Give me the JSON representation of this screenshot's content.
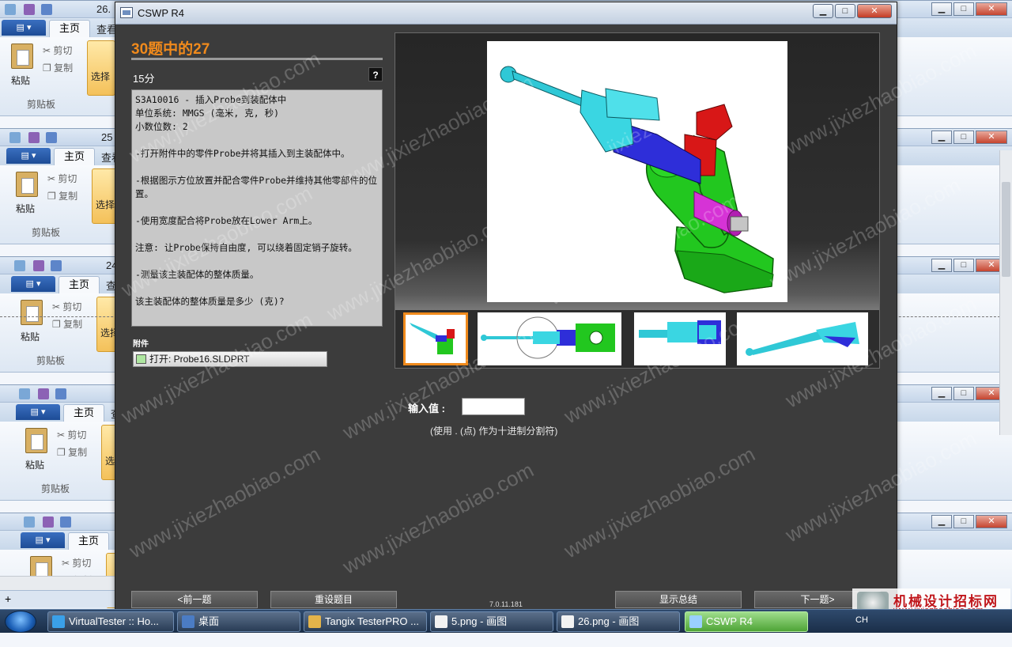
{
  "background_windows": {
    "tab_home": "主页",
    "tab_view": "查看",
    "paste_label": "粘贴",
    "cut_label": "剪切",
    "copy_label": "复制",
    "select_label": "选择",
    "clipboard_group": "剪贴板",
    "numbers": [
      "26.",
      "25",
      "24",
      "",
      ""
    ],
    "status_text": "+"
  },
  "dialog": {
    "title": "CSWP R4",
    "question_heading": "30题中的27",
    "points": "15分",
    "help": "?",
    "question_lines": [
      "S3A10016 - 插入Probe到装配体中",
      "单位系统: MMGS (毫米, 克, 秒)",
      "小数位数: 2",
      "",
      "-打开附件中的零件Probe并将其插入到主装配体中。",
      "",
      "-根据图示方位放置并配合零件Probe并维持其他零部件的位置。",
      "",
      "-使用宽度配合将Probe放在Lower Arm上。",
      "",
      "注意: 让Probe保持自由度, 可以绕着固定销子旋转。",
      "",
      "-测量该主装配体的整体质量。",
      "",
      "该主装配体的整体质量是多少 (克)?"
    ],
    "attachments_label": "附件",
    "attachment_button": "打开: Probe16.SLDPRT",
    "input_label": "输入值 :",
    "input_value": "",
    "input_hint": "(使用 . (点) 作为十进制分割符)",
    "version": "7.0.11.181",
    "buttons": {
      "prev": "<前一题",
      "reset": "重设题目",
      "summary": "显示总结",
      "next": "下一题>"
    }
  },
  "watermark": "www.jixiezhaobiao.com",
  "branding": {
    "name": "机械设计招标网",
    "url": "www.jixiezhaobiao.com"
  },
  "taskbar": {
    "items": [
      {
        "label": "VirtualTester :: Ho...",
        "icon": "ie-icon"
      },
      {
        "label": "桌面",
        "icon": "desktop-icon"
      },
      {
        "label": "Tangix TesterPRO ...",
        "icon": "folder-icon"
      },
      {
        "label": "5.png - 画图",
        "icon": "paint-icon"
      },
      {
        "label": "26.png - 画图",
        "icon": "paint-icon"
      },
      {
        "label": "CSWP R4",
        "icon": "window-icon"
      }
    ],
    "tray_lang": "CH"
  }
}
